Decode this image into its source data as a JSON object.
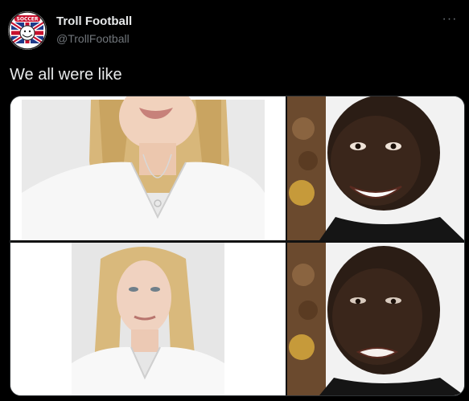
{
  "tweet": {
    "display_name": "Troll Football",
    "handle": "@TrollFootball",
    "text": "We all were like",
    "more_icon": "more-horizontal-icon",
    "avatar_icon": "troll-football-logo",
    "avatar_logo_text": "SOCCER",
    "media": {
      "panels": [
        {
          "position": "top-left",
          "description": "woman-portrait-smiling"
        },
        {
          "position": "top-right",
          "description": "man-smiling-happy"
        },
        {
          "position": "bottom-left",
          "description": "man-portrait-long-blonde-hair"
        },
        {
          "position": "bottom-right",
          "description": "man-disappointed"
        }
      ]
    }
  },
  "colors": {
    "background": "#000000",
    "text_primary": "#e7e9ea",
    "text_secondary": "#71767b",
    "border": "#2f3336"
  }
}
